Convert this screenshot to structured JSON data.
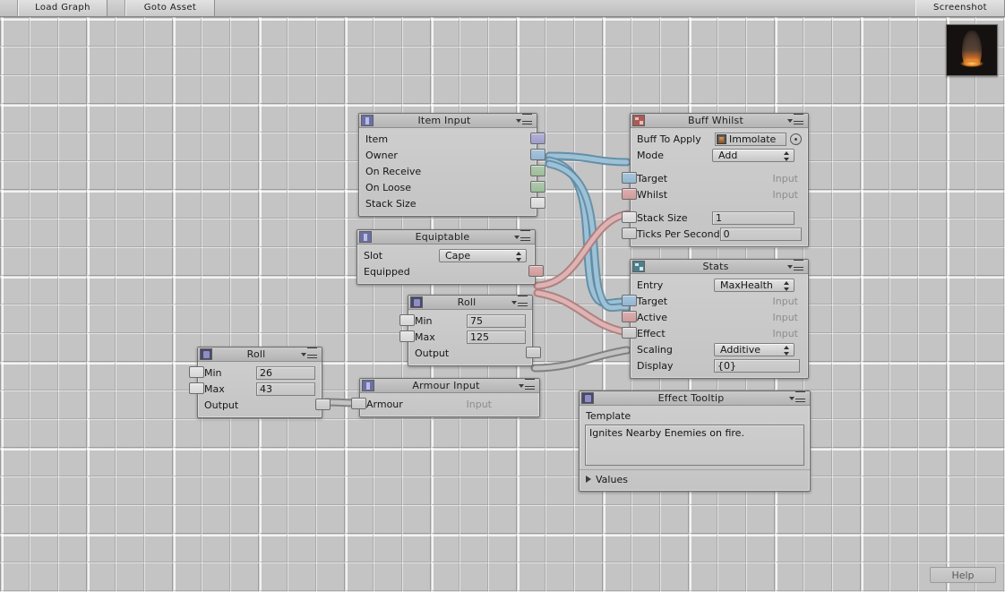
{
  "toolbar": {
    "load_graph": "Load Graph",
    "goto_asset": "Goto Asset",
    "screenshot": "Screenshot"
  },
  "footer": {
    "help": "Help"
  },
  "nodes": {
    "item_input": {
      "title": "Item Input",
      "icon": "node-blue-icon",
      "outputs": [
        {
          "label": "Item",
          "color": "#a5a4d1"
        },
        {
          "label": "Owner",
          "color": "#9bbcd5"
        },
        {
          "label": "On Receive",
          "color": "#a6c6a4"
        },
        {
          "label": "On Loose",
          "color": "#a6c6a4"
        },
        {
          "label": "Stack Size",
          "color": "#dedede"
        }
      ]
    },
    "buff_whilst": {
      "title": "Buff Whilst",
      "icon": "node-red-icon",
      "buff_to_apply_label": "Buff To Apply",
      "buff_to_apply_value": "Immolate",
      "mode_label": "Mode",
      "mode_value": "Add",
      "target_label": "Target",
      "target_value": "Input",
      "whilst_label": "Whilst",
      "whilst_value": "Input",
      "stack_size_label": "Stack Size",
      "stack_size_value": "1",
      "ticks_label": "Ticks Per Second",
      "ticks_value": "0"
    },
    "equiptable": {
      "title": "Equiptable",
      "icon": "node-blue-icon",
      "slot_label": "Slot",
      "slot_value": "Cape",
      "equipped_label": "Equipped"
    },
    "stats": {
      "title": "Stats",
      "icon": "node-teal-icon",
      "entry_label": "Entry",
      "entry_value": "MaxHealth",
      "target_label": "Target",
      "target_value": "Input",
      "active_label": "Active",
      "active_value": "Input",
      "effect_label": "Effect",
      "effect_value": "Input",
      "scaling_label": "Scaling",
      "scaling_value": "Additive",
      "display_label": "Display",
      "display_value": "{0}"
    },
    "roll_top": {
      "title": "Roll",
      "icon": "node-dark-icon",
      "min_label": "Min",
      "min_value": "75",
      "max_label": "Max",
      "max_value": "125",
      "output_label": "Output"
    },
    "roll_bottom": {
      "title": "Roll",
      "icon": "node-dark-icon",
      "min_label": "Min",
      "min_value": "26",
      "max_label": "Max",
      "max_value": "43",
      "output_label": "Output"
    },
    "armour_input": {
      "title": "Armour Input",
      "icon": "node-blue-icon",
      "armour_label": "Armour",
      "armour_value": "Input"
    },
    "effect_tooltip": {
      "title": "Effect Tooltip",
      "icon": "node-dark-icon",
      "template_label": "Template",
      "template_value": "Ignites Nearby Enemies on fire.",
      "values_label": "Values"
    }
  },
  "colors": {
    "wire_blue": "#7fa7c0",
    "wire_red": "#c99a9a",
    "wire_gray": "#9e9e9e",
    "canvas_bg": "#c4c4c4",
    "node_bg": "#c8c8c8"
  }
}
